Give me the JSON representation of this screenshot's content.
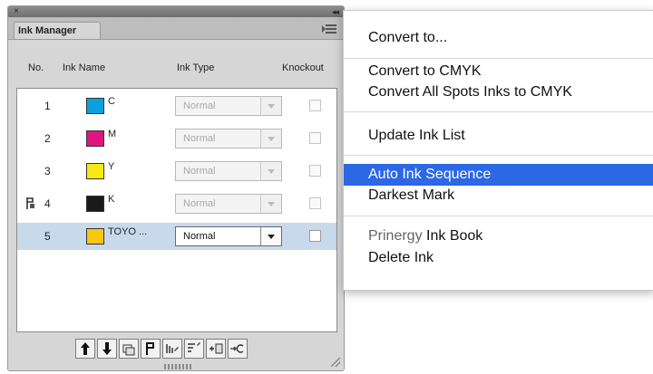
{
  "panel": {
    "tab_label": "Ink Manager",
    "columns": {
      "no": "No.",
      "name": "Ink Name",
      "type": "Ink Type",
      "knockout": "Knockout"
    },
    "rows": [
      {
        "no": "1",
        "name": "C",
        "type": "Normal",
        "color": "#0aa0e0",
        "selected": false
      },
      {
        "no": "2",
        "name": "M",
        "type": "Normal",
        "color": "#e0157f",
        "selected": false
      },
      {
        "no": "3",
        "name": "Y",
        "type": "Normal",
        "color": "#f7ea14",
        "selected": false
      },
      {
        "no": "4",
        "name": "K",
        "type": "Normal",
        "color": "#1a1a1a",
        "selected": false
      },
      {
        "no": "5",
        "name": "TOYO ...",
        "type": "Normal",
        "color": "#f7c80f",
        "selected": true
      }
    ],
    "toolbar_buttons": [
      "move-up",
      "move-down",
      "duplicate",
      "sequence",
      "ink-book",
      "sort",
      "new-ink",
      "convert"
    ]
  },
  "menu": {
    "items": {
      "convert_to": "Convert to...",
      "convert_cmyk": "Convert to CMYK",
      "convert_all": "Convert All Spots Inks to CMYK",
      "update_list": "Update Ink List",
      "auto_sequence": "Auto Ink Sequence",
      "darkest_mark": "Darkest Mark",
      "ink_book_prefix": "Prinergy",
      "ink_book_suffix": " Ink Book",
      "delete_ink": "Delete Ink"
    },
    "highlighted": "Auto Ink Sequence",
    "highlight_color": "#2c67e6"
  }
}
